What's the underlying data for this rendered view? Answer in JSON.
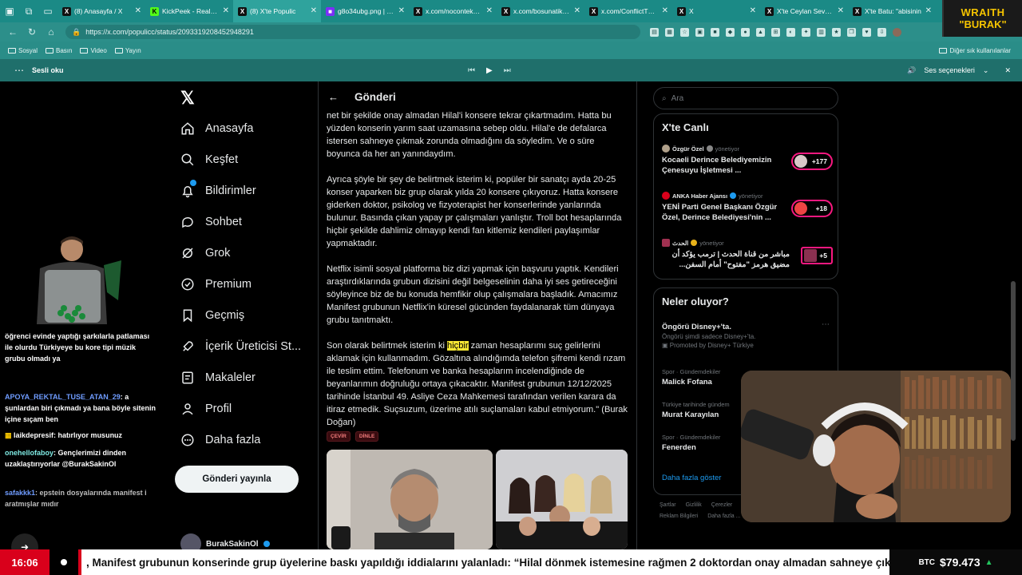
{
  "tabs": [
    {
      "label": "(8) Anasayfa / X",
      "fav": "X",
      "favbg": "#111",
      "favfg": "#fff"
    },
    {
      "label": "KickPeek - Real-time",
      "fav": "K",
      "favbg": "#53fc18",
      "favfg": "#000"
    },
    {
      "label": "(8) X'te Populic",
      "fav": "X",
      "favbg": "#111",
      "favfg": "#fff",
      "active": true
    },
    {
      "label": "g8o34ubg.png | Hos",
      "fav": "■",
      "favbg": "#7b2ff7",
      "favfg": "#fff"
    },
    {
      "label": "x.com/noconteks12",
      "fav": "X",
      "favbg": "#111",
      "favfg": "#fff"
    },
    {
      "label": "x.com/bosunatiklam",
      "fav": "X",
      "favbg": "#111",
      "favfg": "#fff"
    },
    {
      "label": "x.com/ConflictTR/st",
      "fav": "X",
      "favbg": "#111",
      "favfg": "#fff"
    },
    {
      "label": "X",
      "fav": "X",
      "favbg": "#111",
      "favfg": "#fff"
    },
    {
      "label": "X'te Ceylan Sever: \"",
      "fav": "X",
      "favbg": "#111",
      "favfg": "#fff"
    },
    {
      "label": "X'te Batu: \"abisinin",
      "fav": "X",
      "favbg": "#111",
      "favfg": "#fff"
    }
  ],
  "brand": {
    "line1": "WRAITH",
    "line2": "\"BURAK\""
  },
  "address": {
    "url": "https://x.com/populicc/status/2093319208452948291"
  },
  "bookmarks": {
    "items": [
      "Sosyal",
      "Basın",
      "Video",
      "Yayın"
    ],
    "right": "Diğer sık kullanılanlar"
  },
  "readaloud": {
    "label": "Sesli oku",
    "voice": "Ses seçenekleri"
  },
  "nav": {
    "items": [
      "Anasayfa",
      "Keşfet",
      "Bildirimler",
      "Sohbet",
      "Grok",
      "Premium",
      "Geçmiş",
      "İçerik Üreticisi St...",
      "Makaleler",
      "Profil",
      "Daha fazla"
    ],
    "post_button": "Gönderi yayınla",
    "account": "BurakSakinOl"
  },
  "post": {
    "header": "Gönderi",
    "p1": "net bir şekilde onay almadan Hilal'i konsere tekrar çıkartmadım. Hatta bu yüzden konserin yarım saat uzamasına sebep oldu. Hilal'e de defalarca istersen sahneye çıkmak zorunda olmadığını da söyledim. Ve o süre boyunca da her an yanındaydım.",
    "p2": "Ayrıca şöyle bir şey de belirtmek isterim ki, popüler bir sanatçı ayda 20-25 konser yaparken biz grup olarak yılda 20 konsere çıkıyoruz. Hatta konsere giderken doktor, psikolog ve fizyoterapist her konserlerinde yanlarında bulunur. Basında çıkan yapay pr çalışmaları yanlıştır. Troll bot hesaplarında hiçbir şekilde dahlimiz olmayıp kendi fan kitlemiz kendileri paylaşımlar yapmaktadır.",
    "p3": "Netflix isimli sosyal platforma biz dizi yapmak için başvuru yaptık. Kendileri araştırdıklarında grubun dizisini değil belgeselinin daha iyi ses getireceğini söyleyince biz de bu konuda hemfikir olup çalışmalara başladık. Amacımız Manifest grubunun Netflix'in küresel gücünden faydalanarak tüm dünyaya grubu tanıtmaktı.",
    "p4a": "Son olarak belirtmek isterim ki ",
    "p4hl": "hiçbir",
    "p4b": " zaman hesaplarımı suç gelirlerini aklamak için kullanmadım. Gözaltına alındığımda telefon şifremi kendi rızam ile teslim ettim. Telefonum ve banka hesaplarım incelendiğinde de beyanlarımın doğruluğu ortaya çıkacaktır.   Manifest grubunun 12/12/2025 tarihinde İstanbul 49. Asliye Ceza Mahkemesi tarafından verilen karara da itiraz etmedik. Suçsuzum, üzerime atılı suçlamaları kabul etmiyorum.\" (Burak Doğan)",
    "tags": [
      "ÇEVİR",
      "DİNLE"
    ]
  },
  "sidebar": {
    "search_placeholder": "Ara",
    "live_title": "X'te Canlı",
    "live": [
      {
        "who": "Özgür Özel",
        "role": "yönetiyor",
        "desc": "Kocaeli Derince Belediyemizin Çenesuyu İşletmesi ...",
        "count": "+177"
      },
      {
        "who": "ANKA Haber Ajansı",
        "role": "yönetiyor",
        "desc": "YENİ Parti Genel Başkanı Özgür Özel, Derince Belediyesi'nin ...",
        "count": "+18"
      },
      {
        "who": "الحدث",
        "role": "yönetiyor",
        "desc": "مباشر من قناة الحدث | ترمب يؤكد أن مضيق هرمز \"مفتوح\" أمام السفن...",
        "count": "+5"
      }
    ],
    "trend_title": "Neler oluyor?",
    "trends": [
      {
        "cat": "",
        "name": "Öngörü Disney+'ta.",
        "sub": "Öngörü şimdi sadece Disney+'ta.",
        "promo": "Promoted by Disney+ Türkiye"
      },
      {
        "cat": "Spor · Gündemdekiler",
        "name": "Malick Fofana",
        "sub": "",
        "promo": ""
      },
      {
        "cat": "Türkiye tarihinde gündem",
        "name": "Murat Karayılan",
        "sub": "",
        "promo": ""
      },
      {
        "cat": "Spor · Gündemdekiler",
        "name": "Fenerden",
        "sub": "",
        "promo": ""
      }
    ],
    "show_more": "Daha fazla göster",
    "footer": [
      "Şartlar",
      "Gizlilik",
      "Çerezler",
      "Reklam Bilgileri",
      "Daha fazla ..."
    ]
  },
  "chat": [
    {
      "user": "",
      "text": "öğrenci evinde yaptığı şarkılarla patlaması ile olurdu Türkiyeye bu kore tipi müzik grubu olmadı ya"
    },
    {
      "user": "APOYA_REKTAL_TUSE_ATAN_29",
      "text": "a şunlardan biri çıkmadı ya bana böyle sitenin içine sıçam ben"
    },
    {
      "user": "",
      "text": "laikdepresif: hatırlıyor musunuz"
    },
    {
      "user": "onehellofaboy",
      "text": "Gençlerimizi dinden uzaklaştırıyorlar @BurakSakinOl"
    },
    {
      "user": "safakkk1",
      "text": "epstein dosyalarında manifest i aratmışlar mıdır"
    }
  ],
  "ticker": {
    "time": "16:06",
    "headline": ", Manifest grubunun konserinde grup üyelerine baskı yapıldığı iddialarını yalanladı: “Hilal dönmek istemesine rağmen 2 doktordan onay almadan sahneye çıka",
    "btc_label": "BTC",
    "btc_value": "$79.473"
  }
}
